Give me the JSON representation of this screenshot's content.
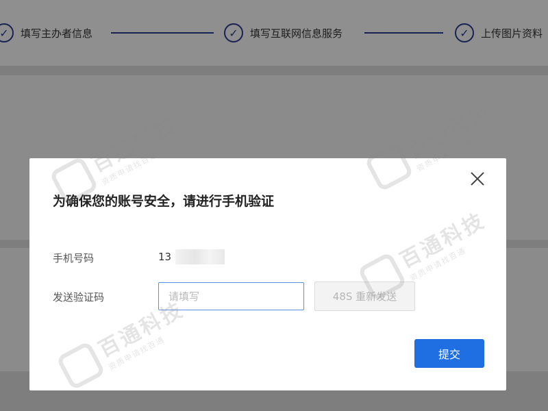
{
  "steps": [
    {
      "label": "填写主办者信息"
    },
    {
      "label": "填写互联网信息服务"
    },
    {
      "label": "上传图片资料"
    }
  ],
  "modal": {
    "title": "为确保您的账号安全，请进行手机验证",
    "phone_label": "手机号码",
    "phone_value": "13",
    "code_label": "发送验证码",
    "code_placeholder": "请填写",
    "resend_label": "48S 重新发送",
    "submit_label": "提交"
  },
  "watermark": {
    "brand": "百通科技",
    "tagline": "资质申请找百通"
  },
  "colors": {
    "accent": "#1f6fe2",
    "step": "#2b3a8e"
  }
}
